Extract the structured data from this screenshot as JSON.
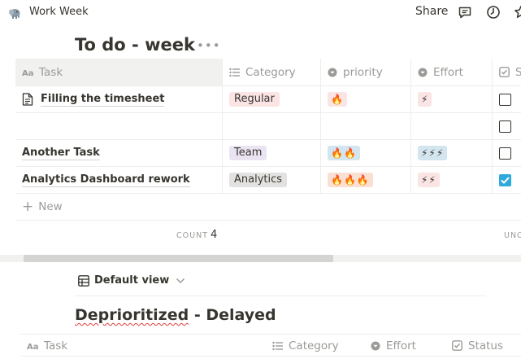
{
  "topbar": {
    "workspace_icon": "elephant-icon",
    "workspace_title": "Work Week",
    "share_label": "Share",
    "icons": [
      "comment-icon",
      "clock-icon",
      "star-icon"
    ]
  },
  "page": {
    "title": "To do - week",
    "more_label": "•••"
  },
  "table": {
    "headers": {
      "task": "Task",
      "category": "Category",
      "priority": "priority",
      "effort": "Effort",
      "status": "S"
    },
    "rows": [
      {
        "task": "Filling the timesheet",
        "has_page_icon": true,
        "category": "Regular",
        "category_color": "#fbe4e4",
        "priority": "🔥",
        "effort": "⚡",
        "done": false
      },
      {
        "task": "",
        "has_page_icon": false,
        "category": "",
        "category_color": "",
        "priority": "",
        "effort": "",
        "done": false
      },
      {
        "task": "Another Task",
        "has_page_icon": false,
        "category": "Team",
        "category_color": "#eae4f2",
        "priority": "🔥🔥",
        "effort": "⚡⚡⚡",
        "done": false
      },
      {
        "task": "Analytics Dashboard rework",
        "has_page_icon": false,
        "category": "Analytics",
        "category_color": "#e3e2e0",
        "priority": "🔥🔥🔥",
        "effort": "⚡⚡",
        "done": true
      }
    ],
    "new_label": "New",
    "count_label": "COUNT",
    "count_value": "4",
    "uncounted_label": "UNC"
  },
  "colors": {
    "priority_pill": "#fae0d3",
    "priority_pill_small": "#fbe4e4",
    "priority_pill_team": "#d3e5ef",
    "effort_pill": "#fbe4e4",
    "effort_pill_team": "#d3e5ef",
    "checkbox_on": "#2eaadc"
  },
  "second": {
    "view_label": "Default view",
    "title_underlined": "Deprioritized",
    "title_rest": " - Delayed",
    "headers": {
      "task": "Task",
      "category": "Category",
      "effort": "Effort",
      "status": "Status"
    }
  }
}
